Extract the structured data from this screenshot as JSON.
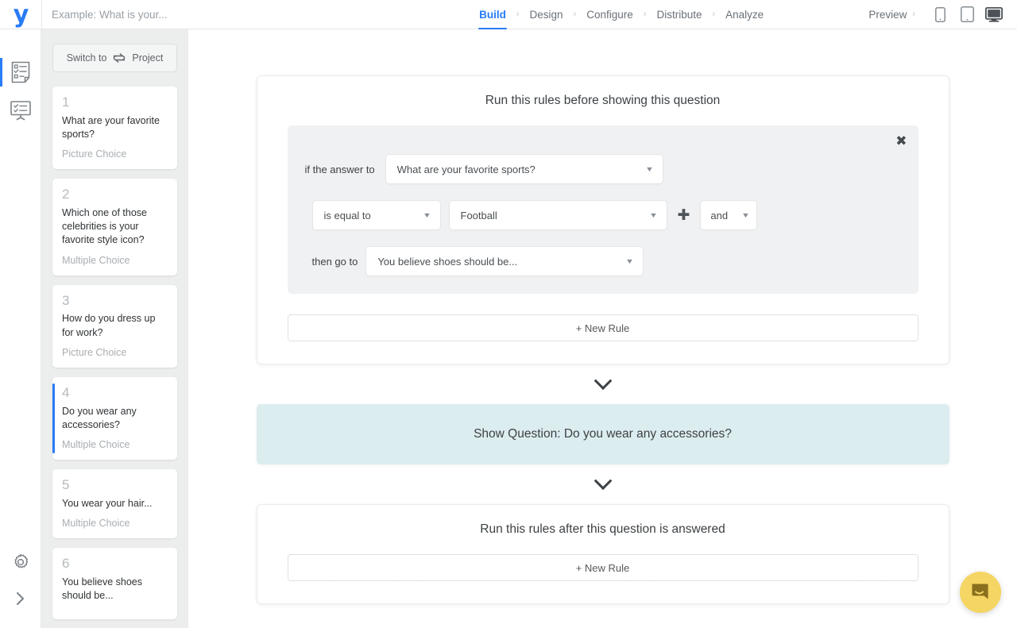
{
  "brand": {
    "logo_letter": "y",
    "logo_color": "#2a7cf7",
    "accent": "#2a7cf7"
  },
  "topbar": {
    "title_placeholder": "Example: What is your...",
    "title_value": "",
    "steps": [
      {
        "label": "Build",
        "active": true
      },
      {
        "label": "Design",
        "active": false
      },
      {
        "label": "Configure",
        "active": false
      },
      {
        "label": "Distribute",
        "active": false
      },
      {
        "label": "Analyze",
        "active": false
      }
    ],
    "step_separator": "›",
    "preview_label": "Preview",
    "preview_chevron": "›",
    "devices": [
      {
        "name": "phone-icon",
        "selected": false
      },
      {
        "name": "tablet-icon",
        "selected": false
      },
      {
        "name": "desktop-icon",
        "selected": true
      }
    ]
  },
  "rail": {
    "items": [
      {
        "icon": "form-checklist-icon",
        "active": true
      },
      {
        "icon": "presentation-icon",
        "active": false
      }
    ],
    "bottom": [
      {
        "icon": "gear-icon"
      },
      {
        "icon": "chevron-right-icon"
      }
    ]
  },
  "sidebar": {
    "switch_button": {
      "prefix": "Switch to",
      "suffix": "Project",
      "icon": "swap-arrows-icon"
    },
    "questions": [
      {
        "num": "1",
        "text": "What are your favorite sports?",
        "type": "Picture Choice",
        "active": false
      },
      {
        "num": "2",
        "text": "Which one of those celebrities is your favorite style icon?",
        "type": "Multiple Choice",
        "active": false
      },
      {
        "num": "3",
        "text": "How do you dress up for work?",
        "type": "Picture Choice",
        "active": false
      },
      {
        "num": "4",
        "text": "Do you wear any accessories?",
        "type": "Multiple Choice",
        "active": true
      },
      {
        "num": "5",
        "text": "You wear your hair...",
        "type": "Multiple Choice",
        "active": false
      },
      {
        "num": "6",
        "text": "You believe shoes should be...",
        "type": "",
        "active": false
      }
    ]
  },
  "main": {
    "before_panel": {
      "title": "Run this rules before showing this question",
      "close_icon": "✖",
      "rule": {
        "if_label": "if the answer to",
        "question_value": "What are your favorite sports?",
        "operator_value": "is equal to",
        "answer_value": "Football",
        "add_condition_icon": "✚",
        "conjunction_value": "and",
        "then_label": "then go to",
        "goto_value": "You believe shoes should be..."
      },
      "new_rule_label": "+ New Rule"
    },
    "show_banner": {
      "text": "Show Question: Do you wear any accessories?",
      "bg": "#dcedf0"
    },
    "after_panel": {
      "title": "Run this rules after this question is answered",
      "new_rule_label": "+ New Rule"
    },
    "divider_icon": "chevron-down-icon"
  },
  "chat": {
    "icon": "chat-bubble-icon",
    "color": "#f5d563"
  }
}
